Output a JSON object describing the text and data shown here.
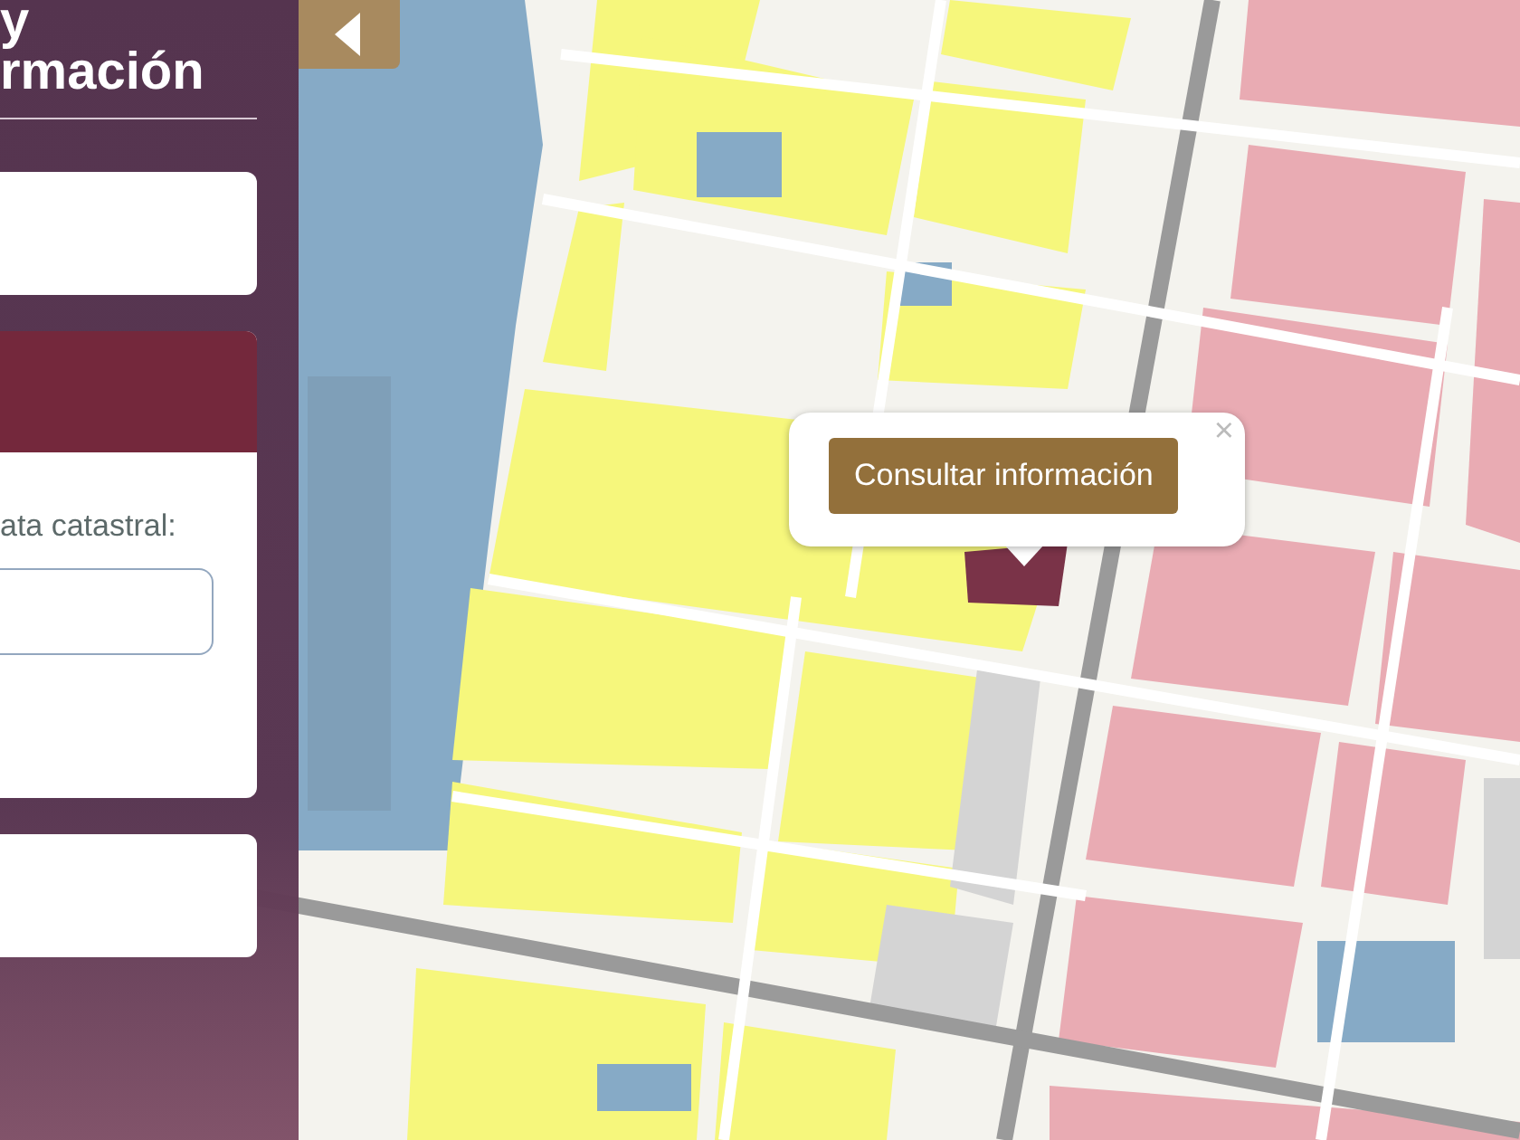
{
  "sidebar": {
    "title_lines": [
      "y",
      "rmación"
    ],
    "cards": [
      {
        "kind": "blank"
      },
      {
        "kind": "form",
        "label": "ata catastral:"
      },
      {
        "kind": "blank"
      }
    ]
  },
  "popup": {
    "button": "Consultar información",
    "close": "×"
  }
}
